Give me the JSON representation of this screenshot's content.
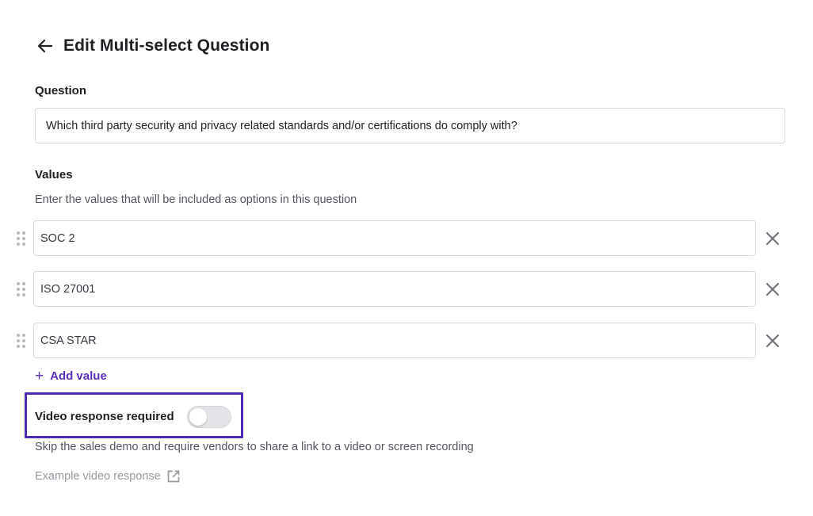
{
  "header": {
    "title": "Edit Multi-select Question",
    "back_icon": "arrow-left-icon"
  },
  "question": {
    "label": "Question",
    "value": "Which third party security and privacy related standards and/or certifications do comply with?"
  },
  "values": {
    "label": "Values",
    "help": "Enter the values that will be included as options in this question",
    "items": [
      {
        "value": "SOC 2"
      },
      {
        "value": "ISO 27001"
      },
      {
        "value": "CSA STAR"
      }
    ],
    "add_label": "Add value",
    "add_icon": "plus-icon",
    "remove_icon": "close-icon",
    "drag_icon": "drag-handle-icon"
  },
  "video": {
    "label": "Video response required",
    "enabled": false,
    "help": "Skip the sales demo and require vendors to share a link to a video or screen recording",
    "example_link": "Example video response",
    "example_icon": "external-link-icon"
  },
  "colors": {
    "accent": "#5b2fbf",
    "highlight_border": "#4f2ab8",
    "text": "#1f1f24",
    "muted": "#55555e",
    "link_muted": "#9a9aa3"
  }
}
